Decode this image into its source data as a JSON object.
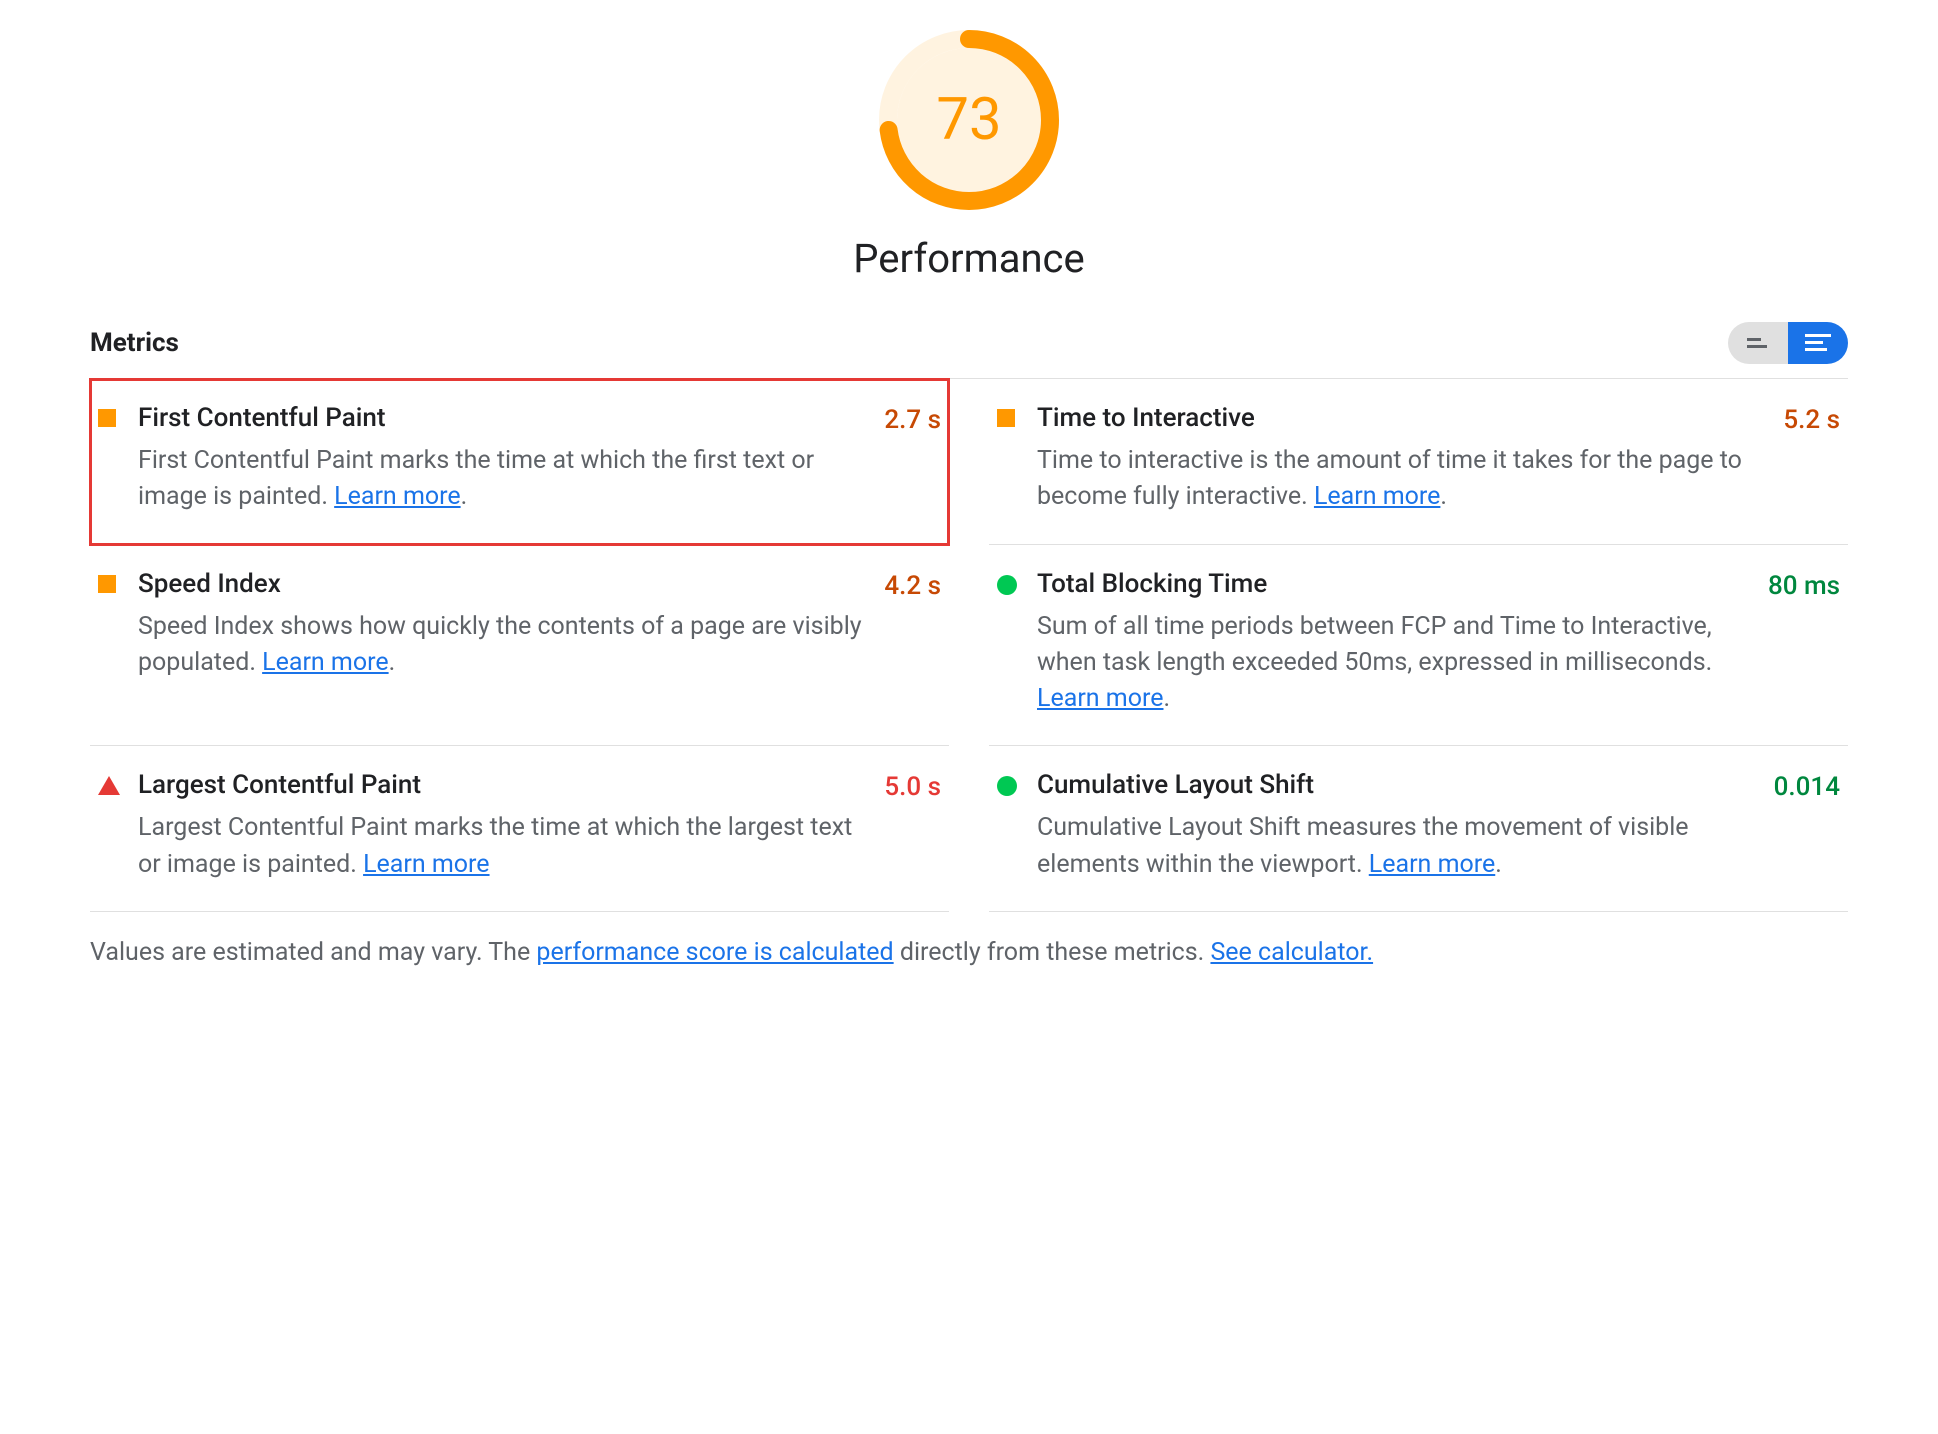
{
  "gauge": {
    "score": "73",
    "percent": 73,
    "title": "Performance",
    "color": "#FF9800",
    "bg": "#FFF3E0"
  },
  "metrics_header": {
    "title": "Metrics"
  },
  "metrics": [
    {
      "icon": "square",
      "title": "First Contentful Paint",
      "description": "First Contentful Paint marks the time at which the first text or image is painted. ",
      "learn_more": "Learn more",
      "learn_suffix": ".",
      "value": "2.7 s",
      "value_class": "val-orange",
      "highlighted": true
    },
    {
      "icon": "square",
      "title": "Time to Interactive",
      "description": "Time to interactive is the amount of time it takes for the page to become fully interactive. ",
      "learn_more": "Learn more",
      "learn_suffix": ".",
      "value": "5.2 s",
      "value_class": "val-orange",
      "highlighted": false
    },
    {
      "icon": "square",
      "title": "Speed Index",
      "description": "Speed Index shows how quickly the contents of a page are visibly populated. ",
      "learn_more": "Learn more",
      "learn_suffix": ".",
      "value": "4.2 s",
      "value_class": "val-orange",
      "highlighted": false
    },
    {
      "icon": "circle",
      "title": "Total Blocking Time",
      "description": "Sum of all time periods between FCP and Time to Interactive, when task length exceeded 50ms, expressed in milliseconds. ",
      "learn_more": "Learn more",
      "learn_suffix": ".",
      "value": "80 ms",
      "value_class": "val-green",
      "highlighted": false
    },
    {
      "icon": "triangle",
      "title": "Largest Contentful Paint",
      "description": "Largest Contentful Paint marks the time at which the largest text or image is painted. ",
      "learn_more": "Learn more",
      "learn_suffix": "",
      "value": "5.0 s",
      "value_class": "val-red",
      "highlighted": false
    },
    {
      "icon": "circle",
      "title": "Cumulative Layout Shift",
      "description": "Cumulative Layout Shift measures the movement of visible elements within the viewport. ",
      "learn_more": "Learn more",
      "learn_suffix": ".",
      "value": "0.014",
      "value_class": "val-green",
      "highlighted": false
    }
  ],
  "footnote": {
    "prefix": "Values are estimated and may vary. The ",
    "link1": "performance score is calculated",
    "mid": " directly from these metrics. ",
    "link2": "See calculator."
  }
}
